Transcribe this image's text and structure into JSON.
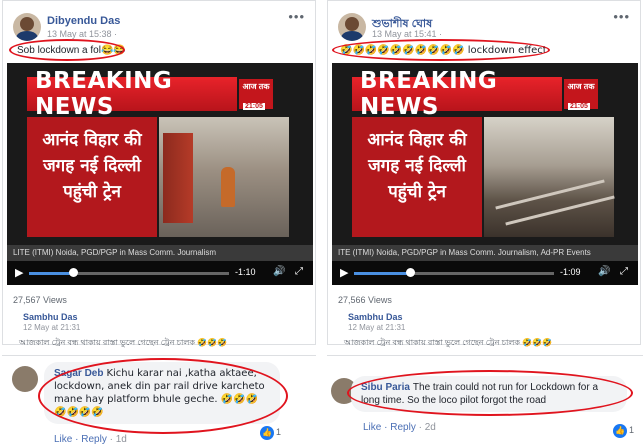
{
  "posts": [
    {
      "author": "Dibyendu Das",
      "date": "13 May at 15:38 ·",
      "caption": "Sob lockdown a fol😂😂",
      "banner": "BREAKING NEWS",
      "channel": "आज तक",
      "clock": "21:05",
      "hindi": "आनंद विहार की जगह नई दिल्ली पहुंची ट्रेन",
      "ticker": "LITE (ITMI) Noida, PGD/PGP in Mass Comm. Journalism",
      "time": "-1:10",
      "progress": 0.22,
      "views": "27,567 Views",
      "shared_author": "Sambhu Das",
      "shared_date": "12 May at 21:31",
      "bengali": "আজকাল ট্রেন বন্ধ থাকায় রাস্তা ভুলে গেছেন ট্রেন চালক 🤣🤣🤣"
    },
    {
      "author": "শুভাশীষ ঘোষ",
      "date": "13 May at 15:41 ·",
      "caption": "🤣🤣🤣🤣🤣🤣🤣🤣🤣🤣 lockdown effect",
      "banner": "BREAKING NEWS",
      "channel": "आज तक",
      "clock": "21:05",
      "hindi": "आनंद विहार की जगह नई दिल्ली पहुंची ट्रेन",
      "ticker": "ITE (ITMI) Noida, PGD/PGP in Mass Comm. Journalism, Ad-PR Events",
      "time": "-1:09",
      "progress": 0.28,
      "views": "27,566 Views",
      "shared_author": "Sambhu Das",
      "shared_date": "12 May at 21:31",
      "bengali": "আজকাল ট্রেন বন্ধ থাকায় রাস্তা ভুলে গেছেন ট্রেন চালক 🤣🤣🤣"
    }
  ],
  "comments": [
    {
      "name": "Sagar Deb",
      "text": "Kichu karar nai ,katha aktaee, lockdown, anek din par rail drive karcheto mane hay platform bhule geche. 🤣🤣🤣🤣🤣🤣🤣",
      "like": "Like",
      "reply": "Reply",
      "meta": "· 1d",
      "reactions": "1"
    },
    {
      "name": "Sibu Paria",
      "text": "The train could not run for Lockdown for a long time. So the loco pilot forgot the road",
      "like": "Like",
      "reply": "Reply",
      "meta": "· 2d",
      "reactions": "1"
    }
  ],
  "ui": {
    "menu": "•••",
    "play": "▶",
    "volume": "🔊",
    "fullscreen": "⤢",
    "reaction_icon": "like-icon",
    "highlight_color": "#e0141e"
  }
}
